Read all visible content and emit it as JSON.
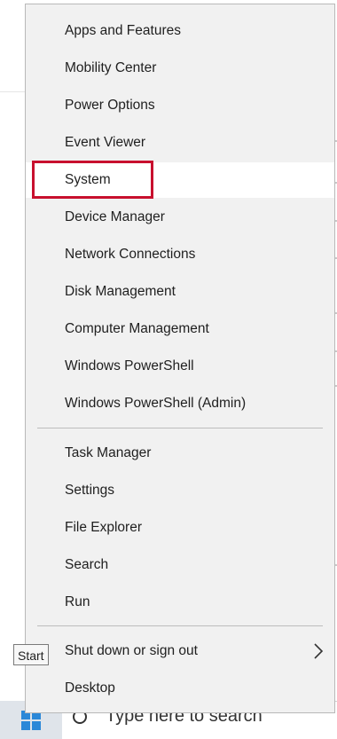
{
  "taskbar": {
    "search_placeholder": "Type here to search",
    "start_tooltip": "Start"
  },
  "menu": {
    "groups": [
      {
        "items": [
          {
            "label": "Apps and Features"
          },
          {
            "label": "Mobility Center"
          },
          {
            "label": "Power Options"
          },
          {
            "label": "Event Viewer"
          },
          {
            "label": "System",
            "highlighted": true
          },
          {
            "label": "Device Manager"
          },
          {
            "label": "Network Connections"
          },
          {
            "label": "Disk Management"
          },
          {
            "label": "Computer Management"
          },
          {
            "label": "Windows PowerShell"
          },
          {
            "label": "Windows PowerShell (Admin)"
          }
        ]
      },
      {
        "items": [
          {
            "label": "Task Manager"
          },
          {
            "label": "Settings"
          },
          {
            "label": "File Explorer"
          },
          {
            "label": "Search"
          },
          {
            "label": "Run"
          }
        ]
      },
      {
        "items": [
          {
            "label": "Shut down or sign out",
            "has_submenu": true
          },
          {
            "label": "Desktop"
          }
        ]
      }
    ]
  },
  "colors": {
    "menu_bg": "#f1f1f1",
    "highlight_border": "#c8102e",
    "accent_blue": "#2b88d8"
  },
  "icons": {
    "submenu": "chevron-right-icon",
    "start": "windows-logo-icon",
    "search": "search-icon"
  }
}
